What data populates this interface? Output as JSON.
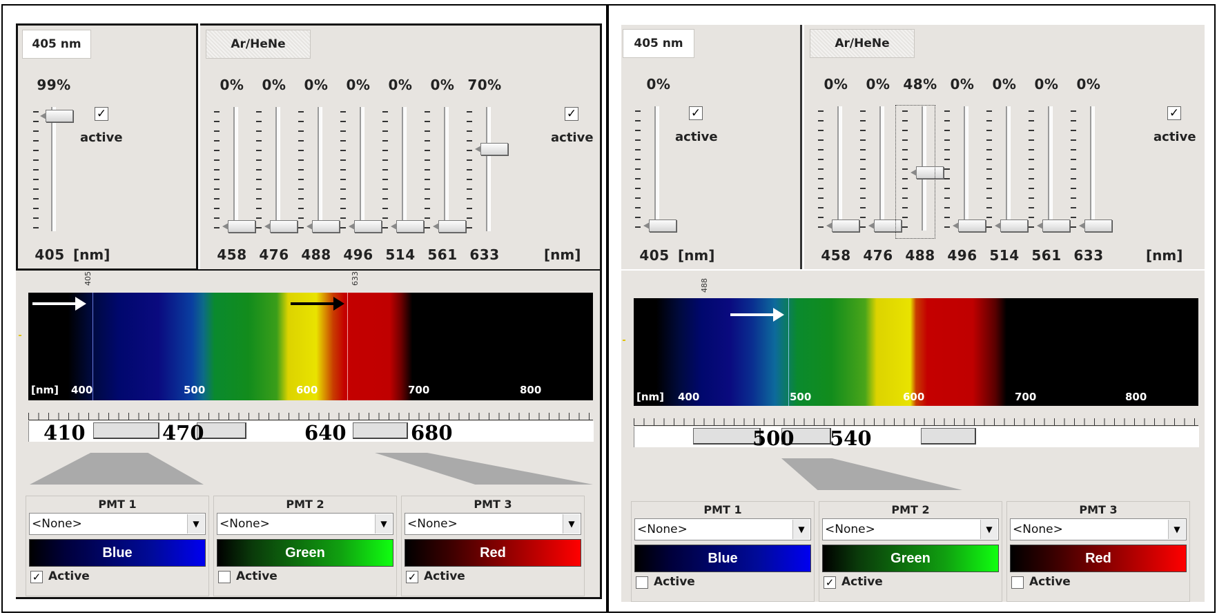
{
  "left": {
    "laser405": {
      "tab": "405 nm",
      "percent": "99%",
      "wavelength": "405",
      "unit": "[nm]",
      "active_label": "active",
      "active_check": "✓",
      "level": 0.99
    },
    "arhene": {
      "tab": "Ar/HeNe",
      "percents": [
        "0%",
        "0%",
        "0%",
        "0%",
        "0%",
        "0%",
        "70%"
      ],
      "wavelengths": [
        "458",
        "476",
        "488",
        "496",
        "514",
        "561",
        "633"
      ],
      "levels": [
        0,
        0,
        0,
        0,
        0,
        0,
        0.7
      ],
      "unit": "[nm]",
      "active_label": "active",
      "active_check": "✓"
    },
    "spectrum": {
      "unit": "[nm]",
      "labels": [
        "400",
        "500",
        "600",
        "700",
        "800"
      ],
      "markers": [
        "405",
        "633"
      ]
    },
    "bands": [
      "410",
      "470",
      "640",
      "680"
    ],
    "pmts": [
      {
        "title": "PMT 1",
        "select": "<None>",
        "color": "Blue",
        "active": "Active",
        "checked": "✓"
      },
      {
        "title": "PMT 2",
        "select": "<None>",
        "color": "Green",
        "active": "Active",
        "checked": ""
      },
      {
        "title": "PMT 3",
        "select": "<None>",
        "color": "Red",
        "active": "Active",
        "checked": "✓"
      }
    ]
  },
  "right": {
    "laser405": {
      "tab": "405 nm",
      "percent": "0%",
      "wavelength": "405",
      "unit": "[nm]",
      "active_label": "active",
      "active_check": "✓",
      "level": 0
    },
    "arhene": {
      "tab": "Ar/HeNe",
      "percents": [
        "0%",
        "0%",
        "48%",
        "0%",
        "0%",
        "0%",
        "0%"
      ],
      "wavelengths": [
        "458",
        "476",
        "488",
        "496",
        "514",
        "561",
        "633"
      ],
      "levels": [
        0,
        0,
        0.48,
        0,
        0,
        0,
        0
      ],
      "unit": "[nm]",
      "active_label": "active",
      "active_check": "✓"
    },
    "spectrum": {
      "unit": "[nm]",
      "labels": [
        "400",
        "500",
        "600",
        "700",
        "800"
      ],
      "markers": [
        "488"
      ]
    },
    "bands": [
      "500",
      "540"
    ],
    "pmts": [
      {
        "title": "PMT 1",
        "select": "<None>",
        "color": "Blue",
        "active": "Active",
        "checked": ""
      },
      {
        "title": "PMT 2",
        "select": "<None>",
        "color": "Green",
        "active": "Active",
        "checked": "✓"
      },
      {
        "title": "PMT 3",
        "select": "<None>",
        "color": "Red",
        "active": "Active",
        "checked": ""
      }
    ]
  },
  "colors": {
    "panel_bg": "#e7e4e0",
    "blue": "#0000f0",
    "green": "#10ff10",
    "red": "#ff0000"
  }
}
